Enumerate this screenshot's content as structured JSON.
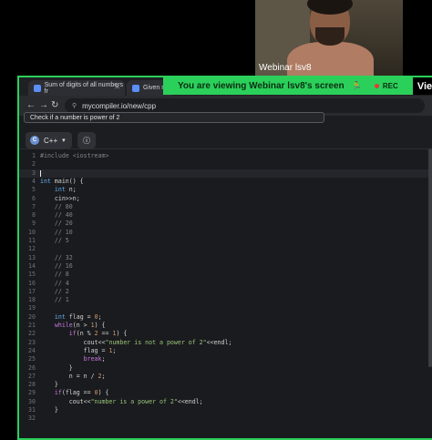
{
  "webcam": {
    "name": "Webinar lsv8"
  },
  "browser": {
    "tabs": [
      {
        "label": "Sum of digits of all numbers fr"
      },
      {
        "label": "Given n a"
      }
    ],
    "url": "mycompiler.io/new/cpp"
  },
  "share_banner": {
    "text": "You are viewing  Webinar lsv8's screen",
    "rec_label": "REC",
    "overflow_label": "Vie"
  },
  "editor": {
    "title": "Check if a number is power of 2",
    "language": "C++",
    "code_lines": [
      "#include <iostream>",
      "",
      "",
      "int main() {",
      "    int n;",
      "    cin>>n;",
      "    // 80",
      "    // 40",
      "    // 20",
      "    // 10",
      "    // 5",
      "",
      "    // 32",
      "    // 16",
      "    // 8",
      "    // 4",
      "    // 2",
      "    // 1",
      "",
      "    int flag = 0;",
      "    while(n > 1) {",
      "        if(n % 2 == 1) {",
      "            cout<<\"number is not a power of 2\"<<endl;",
      "            flag = 1;",
      "            break;",
      "        }",
      "        n = n / 2;",
      "    }",
      "    if(flag == 0) {",
      "        cout<<\"number is a power of 2\"<<endl;",
      "    }",
      ""
    ],
    "active_line": 3
  }
}
